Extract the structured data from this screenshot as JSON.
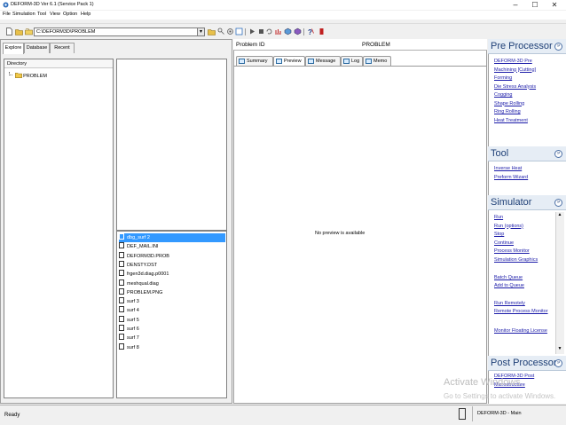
{
  "window": {
    "title": "DEFORM-3D  Ver 6.1 (Service Pack 1)",
    "controls": [
      "–",
      "☐",
      "✕"
    ]
  },
  "menu": [
    "File",
    "Simulation",
    "Tool",
    "View",
    "Option",
    "Help"
  ],
  "toolbar": {
    "path": "C:\\DEFORM3D\\PROBLEM"
  },
  "explorer": {
    "tabs": [
      "Explore",
      "Database",
      "Recent"
    ],
    "directory_header": "Directory",
    "tree_root": "PROBLEM",
    "files": [
      {
        "name": "dbg_surf 2",
        "selected": true
      },
      {
        "name": "DEF_MAIL.INI"
      },
      {
        "name": "DEFORM3D.PROB"
      },
      {
        "name": "DENSTY.DST"
      },
      {
        "name": "frgen3d.diag.p0001"
      },
      {
        "name": "meshqual.diag"
      },
      {
        "name": "PROBLEM.PNG"
      },
      {
        "name": "surf 3"
      },
      {
        "name": "surf 4"
      },
      {
        "name": "surf 5"
      },
      {
        "name": "surf 6"
      },
      {
        "name": "surf 7"
      },
      {
        "name": "surf 8"
      }
    ]
  },
  "problem": {
    "id_label": "Problem ID",
    "id_value": "PROBLEM",
    "tabs": [
      "Summary",
      "Preview",
      "Message",
      "Log",
      "Memo"
    ],
    "active_tab": "Preview",
    "preview_text": "No preview is available"
  },
  "pre_processor": {
    "title": "Pre Processor",
    "links": [
      "DEFORM-3D Pre",
      "Machining [Cutting]",
      "Forming",
      "Die Stress Analysis",
      "Cogging",
      "Shape Rolling",
      "Ring Rolling",
      "Heat Treatment"
    ]
  },
  "tool": {
    "title": "Tool",
    "links": [
      "Inverse Heat",
      "Preform Wizard"
    ]
  },
  "simulator": {
    "title": "Simulator",
    "links": [
      "Run",
      "Run (options)",
      "Stop",
      "Continue",
      "Process Monitor",
      "Simulation Graphics",
      "Batch Queue",
      "Add to Queue",
      "Run Remotely",
      "Remote Process Monitor",
      "Monitor Floating License"
    ]
  },
  "post_processor": {
    "title": "Post Processor",
    "links": [
      "DEFORM-3D Post",
      "Microstructure"
    ]
  },
  "watermark": {
    "line1": "Activate Windows",
    "line2": "Go to Settings to activate Windows."
  },
  "status": {
    "left": "Ready",
    "right": "DEFORM-3D  -  Main"
  }
}
